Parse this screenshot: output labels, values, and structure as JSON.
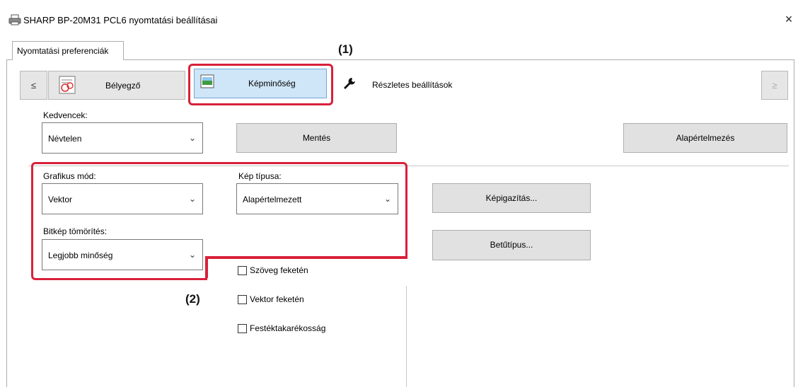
{
  "window": {
    "title": "SHARP BP-20M31 PCL6 nyomtatási beállításai",
    "close_glyph": "×"
  },
  "tabs": [
    {
      "label": "Nyomtatási preferenciák"
    }
  ],
  "nav": {
    "prev_glyph": "≤",
    "next_glyph": "≥",
    "items": [
      {
        "label": "Bélyegző",
        "icon": "stamp-icon"
      },
      {
        "label": "Képminőség",
        "icon": "image-quality-icon"
      },
      {
        "label": "Részletes beállítások",
        "icon": "wrench-icon"
      }
    ]
  },
  "favorites": {
    "label": "Kedvencek:",
    "value": "Névtelen",
    "save_label": "Mentés",
    "default_label": "Alapértelmezés"
  },
  "graphics_mode": {
    "label": "Grafikus mód:",
    "value": "Vektor"
  },
  "image_type": {
    "label": "Kép típusa:",
    "value": "Alapértelmezett"
  },
  "bitmap_compression": {
    "label": "Bitkép tömörítés:",
    "value": "Legjobb minőség"
  },
  "buttons": {
    "image_adjust": "Képigazítás...",
    "font": "Betűtípus..."
  },
  "checkboxes": [
    {
      "label": "Szöveg feketén",
      "checked": false
    },
    {
      "label": "Vektor feketén",
      "checked": false
    },
    {
      "label": "Festéktakarékosság",
      "checked": false
    }
  ],
  "annotations": {
    "callout_1": "(1)",
    "callout_2": "(2)",
    "highlight_color": "#d8213a"
  }
}
